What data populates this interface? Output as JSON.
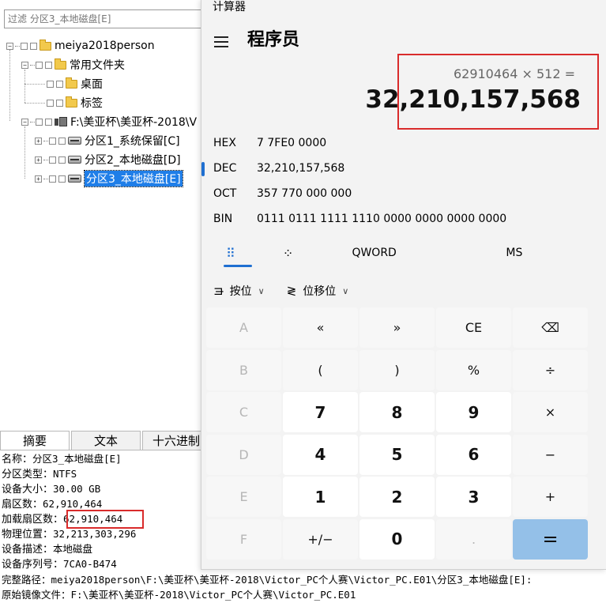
{
  "left": {
    "filter_text": "过滤 分区3_本地磁盘[E]",
    "tree": [
      {
        "label": "meiya2018person",
        "expander": "−"
      },
      {
        "label": "常用文件夹",
        "expander": "−"
      },
      {
        "label": "桌面"
      },
      {
        "label": "标签"
      },
      {
        "label": "F:\\美亚杯\\美亚杯-2018\\V",
        "expander": "−"
      },
      {
        "label": "分区1_系统保留[C]",
        "expander": "+"
      },
      {
        "label": "分区2_本地磁盘[D]",
        "expander": "+"
      },
      {
        "label": "分区3_本地磁盘[E]",
        "expander": "+",
        "selected": true
      }
    ],
    "tabs": [
      "摘要",
      "文本",
      "十六进制"
    ],
    "info": [
      {
        "label": "名称：",
        "value": "分区3_本地磁盘[E]"
      },
      {
        "label": "分区类型：",
        "value": "NTFS"
      },
      {
        "label": "设备大小：",
        "value": "30.00 GB"
      },
      {
        "label": "扇区数：",
        "value": "62,910,464"
      },
      {
        "label": "加载扇区数：",
        "value": "62,910,464"
      },
      {
        "label": "物理位置：",
        "value": "32,213,303,296"
      },
      {
        "label": "设备描述：",
        "value": "本地磁盘"
      },
      {
        "label": "设备序列号：",
        "value": "7CA0-B474"
      }
    ],
    "full_path_label": "完整路径：",
    "full_path": "meiya2018person\\F:\\美亚杯\\美亚杯-2018\\Victor_PC个人赛\\Victor_PC.E01\\分区3_本地磁盘[E]:",
    "orig_image_label": "原始镜像文件：",
    "orig_image": "F:\\美亚杯\\美亚杯-2018\\Victor_PC个人赛\\Victor_PC.E01"
  },
  "calc": {
    "app_title": "计算器",
    "mode_title": "程序员",
    "expression": "62910464 × 512 =",
    "result": "32,210,157,568",
    "radix": [
      {
        "label": "HEX",
        "value": "7 7FE0 0000"
      },
      {
        "label": "DEC",
        "value": "32,210,157,568"
      },
      {
        "label": "OCT",
        "value": "357 770 000 000"
      },
      {
        "label": "BIN",
        "value": "0111 0111 1111 1110 0000 0000 0000 0000"
      }
    ],
    "word_size": "QWORD",
    "memory": "MS",
    "bitwise_label": "按位",
    "bitshift_label": "位移位",
    "keys": [
      "A",
      "«",
      "»",
      "CE",
      "⌫",
      "B",
      "(",
      ")",
      "%",
      "÷",
      "C",
      "7",
      "8",
      "9",
      "×",
      "D",
      "4",
      "5",
      "6",
      "−",
      "E",
      "1",
      "2",
      "3",
      "+",
      "F",
      "+/−",
      "0",
      ".",
      "="
    ],
    "colors": {
      "accent": "#1f6fd1",
      "equals": "#94c0e8",
      "highlight": "#d92b2b"
    }
  }
}
